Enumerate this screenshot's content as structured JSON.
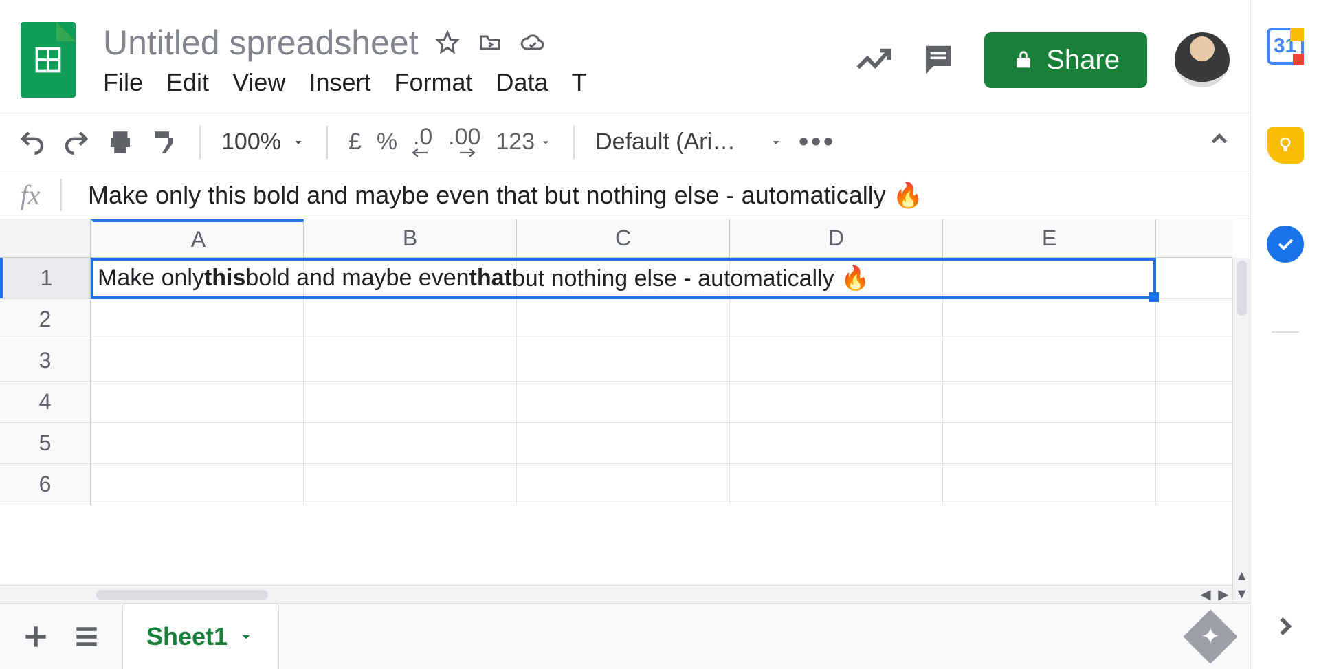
{
  "doc": {
    "title": "Untitled spreadsheet"
  },
  "menus": {
    "file": "File",
    "edit": "Edit",
    "view": "View",
    "insert": "Insert",
    "format": "Format",
    "data": "Data",
    "tools_trunc": "T"
  },
  "share": {
    "label": "Share"
  },
  "toolbar": {
    "zoom": "100%",
    "currency": "£",
    "percent": "%",
    "dec_dec": ".0",
    "inc_dec": ".00",
    "numfmt": "123",
    "font": "Default (Ari…"
  },
  "fx": {
    "label": "fx",
    "segments": [
      {
        "t": "Make only ",
        "b": false
      },
      {
        "t": "this",
        "b": false
      },
      {
        "t": " bold and maybe even ",
        "b": false
      },
      {
        "t": "that",
        "b": false
      },
      {
        "t": " but nothing else - automatically 🔥",
        "b": false
      }
    ]
  },
  "columns": [
    "A",
    "B",
    "C",
    "D",
    "E"
  ],
  "rows": [
    "1",
    "2",
    "3",
    "4",
    "5",
    "6"
  ],
  "cellA1": {
    "segments": [
      {
        "t": "Make only ",
        "b": false
      },
      {
        "t": "this",
        "b": true
      },
      {
        "t": " bold and maybe even ",
        "b": false
      },
      {
        "t": "that",
        "b": true
      },
      {
        "t": " but nothing else - automatically 🔥",
        "b": false
      }
    ]
  },
  "sheet": {
    "name": "Sheet1"
  },
  "side": {
    "cal": "31"
  }
}
